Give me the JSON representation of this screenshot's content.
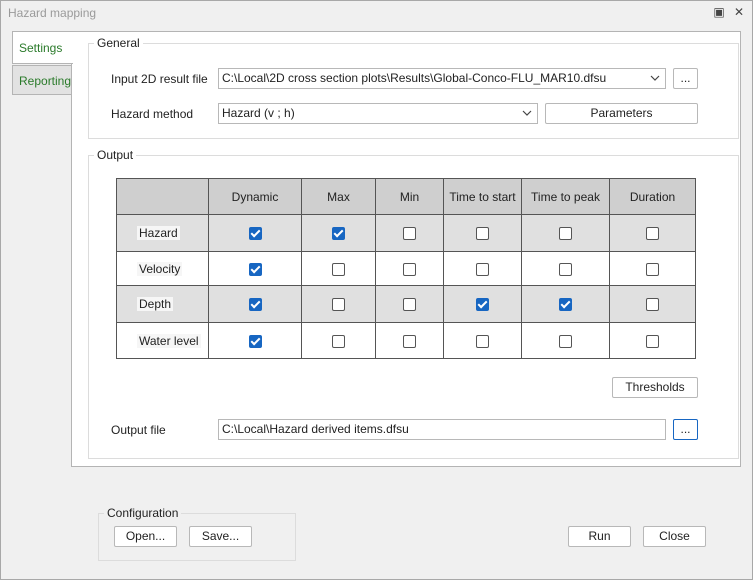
{
  "window": {
    "title": "Hazard mapping"
  },
  "tabs": [
    {
      "label": "Settings"
    },
    {
      "label": "Reporting"
    }
  ],
  "general": {
    "label": "General",
    "input_label": "Input 2D result file",
    "input_value": "C:\\Local\\2D cross section plots\\Results\\Global-Conco-FLU_MAR10.dfsu",
    "browse_label": "...",
    "method_label": "Hazard method",
    "method_value": "Hazard (v ; h)",
    "parameters_label": "Parameters"
  },
  "output": {
    "label": "Output",
    "columns": [
      "",
      "Dynamic",
      "Max",
      "Min",
      "Time to start",
      "Time to peak",
      "Duration"
    ],
    "rows": [
      {
        "label": "Hazard",
        "checks": [
          true,
          true,
          false,
          false,
          false,
          false
        ]
      },
      {
        "label": "Velocity",
        "checks": [
          true,
          false,
          false,
          false,
          false,
          false
        ]
      },
      {
        "label": "Depth",
        "checks": [
          true,
          false,
          false,
          true,
          true,
          false
        ]
      },
      {
        "label": "Water level",
        "checks": [
          true,
          false,
          false,
          false,
          false,
          false
        ]
      }
    ],
    "thresholds_label": "Thresholds",
    "file_label": "Output file",
    "file_value": "C:\\Local\\Hazard derived items.dfsu",
    "browse_label": "..."
  },
  "configuration": {
    "label": "Configuration",
    "open_label": "Open...",
    "save_label": "Save..."
  },
  "actions": {
    "run_label": "Run",
    "close_label": "Close"
  },
  "colors": {
    "accent": "#1766c2",
    "tab_text": "#2a7a2a"
  }
}
